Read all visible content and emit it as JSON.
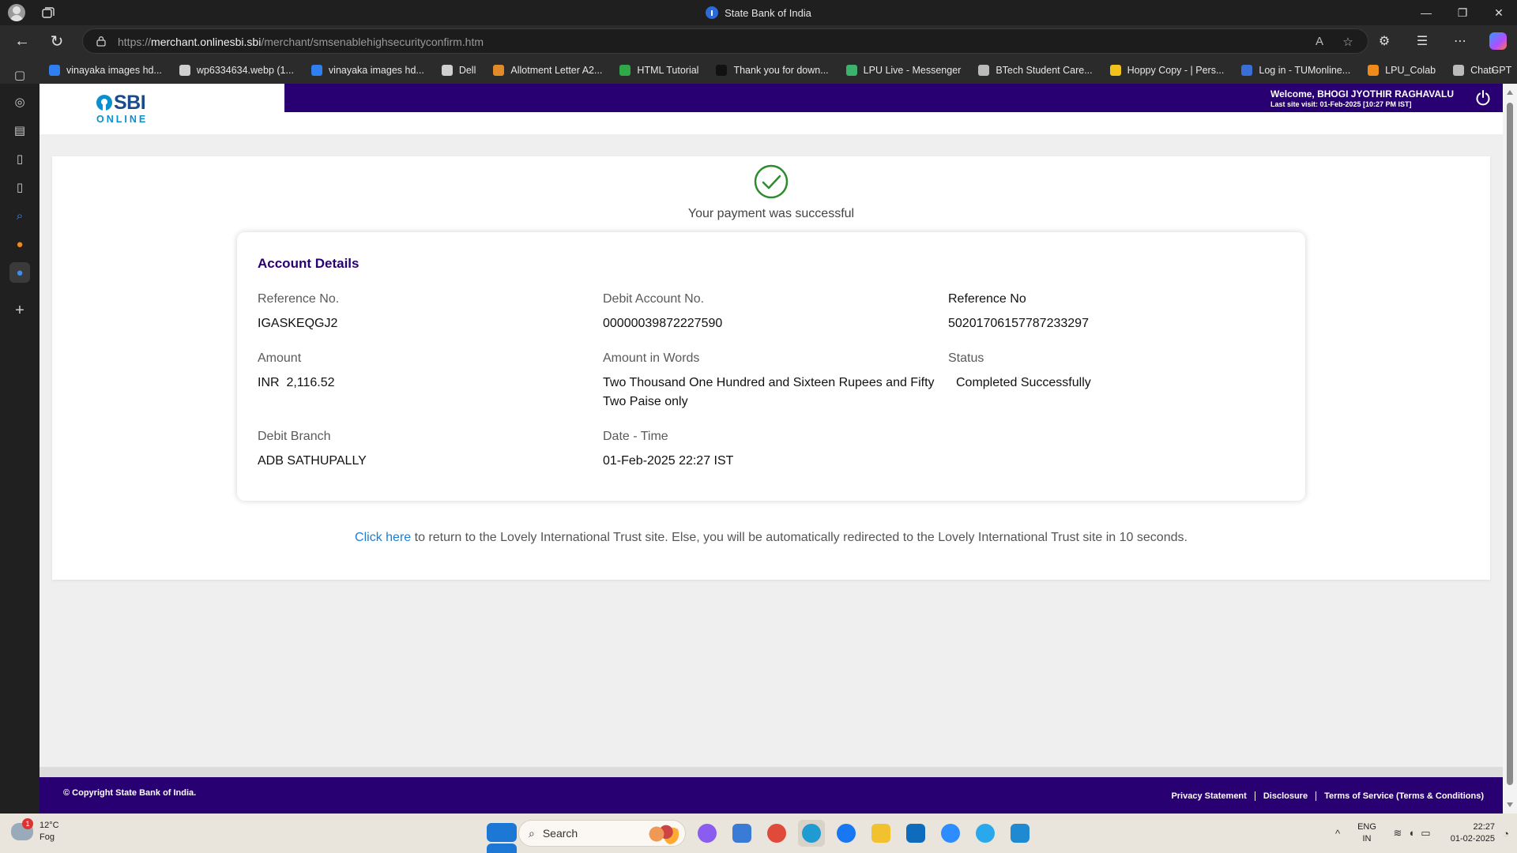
{
  "browser": {
    "window_title": "State Bank of India",
    "url_scheme": "https://",
    "url_host": "merchant.onlinesbi.sbi",
    "url_path": "/merchant/smsenablehighsecurityconfirm.htm",
    "bookmarks": [
      {
        "label": "vinayaka images hd...",
        "color": "#2f7ff0"
      },
      {
        "label": "wp6334634.webp (1...",
        "color": "#cfcfcf"
      },
      {
        "label": "vinayaka images hd...",
        "color": "#2f7ff0"
      },
      {
        "label": "Dell",
        "color": "#cfcfcf"
      },
      {
        "label": "Allotment Letter A2...",
        "color": "#e08a2a"
      },
      {
        "label": "HTML Tutorial",
        "color": "#2fa84a"
      },
      {
        "label": "Thank you for down...",
        "color": "#111111"
      },
      {
        "label": "LPU Live - Messenger",
        "color": "#3bb36a"
      },
      {
        "label": "BTech Student Care...",
        "color": "#bbbbbb"
      },
      {
        "label": "Hoppy Copy - | Pers...",
        "color": "#f1c21b"
      },
      {
        "label": "Log in - TUMonline...",
        "color": "#3a6fd8"
      },
      {
        "label": "LPU_Colab",
        "color": "#f08a1a"
      },
      {
        "label": "ChatGPT",
        "color": "#bbbbbb"
      }
    ]
  },
  "header": {
    "logo_text": "SBI",
    "logo_subtext": "ONLINE",
    "welcome": "Welcome, BHOGI JYOTHIR RAGHAVALU",
    "last_visit": "Last site visit: 01-Feb-2025 [10:27 PM IST]"
  },
  "payment": {
    "success_message": "Your payment was successful",
    "section_title": "Account Details",
    "fields": [
      {
        "label": "Reference No.",
        "value": "IGASKEQGJ2"
      },
      {
        "label": "Debit Account No.",
        "value": "00000039872227590"
      },
      {
        "label": "Reference No",
        "value": "50201706157787233297"
      },
      {
        "label": "Amount",
        "value": "INR  2,116.52"
      },
      {
        "label": "Amount in Words",
        "value": "Two Thousand One Hundred and Sixteen Rupees and Fifty Two Paise only"
      },
      {
        "label": "Status",
        "value": "Completed Successfully"
      },
      {
        "label": "Debit Branch",
        "value": "ADB SATHUPALLY"
      },
      {
        "label": "Date - Time",
        "value": "01-Feb-2025 22:27 IST"
      }
    ],
    "redirect_link": "Click here",
    "redirect_text": " to return to the Lovely International Trust site. Else, you will be automatically redirected to the Lovely International Trust site in 10 seconds."
  },
  "footer": {
    "copyright": "© Copyright State Bank of India.",
    "links": [
      "Privacy Statement",
      "Disclosure",
      "Terms of Service (Terms & Conditions)"
    ]
  },
  "taskbar": {
    "temperature": "12°C",
    "weather": "Fog",
    "search_placeholder": "Search",
    "lang_line1": "ENG",
    "lang_line2": "IN",
    "time": "22:27",
    "date": "01-02-2025",
    "apps": [
      {
        "name": "copilot",
        "color": "#8a5cf0"
      },
      {
        "name": "store",
        "color": "#3a7bd5"
      },
      {
        "name": "chrome",
        "color": "#e04a3a"
      },
      {
        "name": "edge",
        "color": "#1f9bd1"
      },
      {
        "name": "facebook",
        "color": "#1877f2"
      },
      {
        "name": "file-explorer",
        "color": "#f2c12e"
      },
      {
        "name": "outlook",
        "color": "#0f6cbd"
      },
      {
        "name": "zoom",
        "color": "#2d8cff"
      },
      {
        "name": "telegram",
        "color": "#29a9eb"
      },
      {
        "name": "vscode",
        "color": "#1f8ad2"
      }
    ]
  }
}
